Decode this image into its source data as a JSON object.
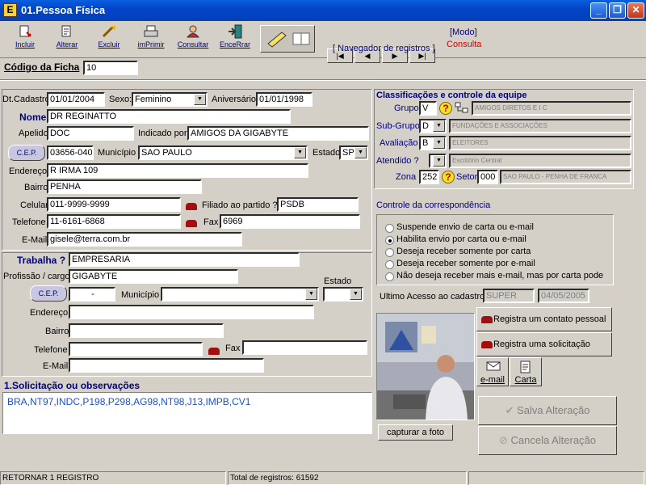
{
  "window": {
    "title": "01.Pessoa Física",
    "app_icon": "E"
  },
  "toolbar": [
    {
      "label": "Incluir",
      "icon": "add-icon"
    },
    {
      "label": "Alterar",
      "icon": "edit-icon"
    },
    {
      "label": "Excluir",
      "icon": "delete-icon"
    },
    {
      "label": "imPrimir",
      "icon": "print-icon"
    },
    {
      "label": "Consultar",
      "icon": "search-icon"
    },
    {
      "label": "EnceRrar",
      "icon": "exit-icon"
    }
  ],
  "navigator": {
    "buttons": [
      "|◀",
      "◀",
      "▶",
      "▶|"
    ],
    "caption": "[ Navegador de registros ]"
  },
  "mode": {
    "label": "[Modo]",
    "value": "Consulta"
  },
  "codigo": {
    "label": "Código da Ficha",
    "value": "10"
  },
  "person": {
    "dt_cadastro_label": "Dt.Cadastro",
    "dt_cadastro": "01/01/2004",
    "sexo_label": "Sexo:",
    "sexo": "Feminino",
    "aniversario_label": "Aniversário",
    "aniversario": "01/01/1998",
    "nome_label": "Nome",
    "nome": "DR REGINATTO",
    "apelido_label": "Apelido",
    "apelido": "DOC",
    "indicado_label": "Indicado por",
    "indicado": "AMIGOS DA GIGABYTE",
    "cep_button": "C.E.P.",
    "cep": "03656-040",
    "municipio_label": "Município",
    "municipio": "SAO PAULO",
    "estado_label": "Estado",
    "estado": "SP",
    "endereco_label": "Endereço",
    "endereco": "R IRMA 109",
    "bairro_label": "Bairro",
    "bairro": "PENHA",
    "celular_label": "Celular",
    "celular": "011-9999-9999",
    "filiado_label": "Filiado ao partido ?",
    "filiado": "PSDB",
    "telefone_label": "Telefone",
    "telefone": "11-6161-6868",
    "fax_label": "Fax",
    "fax": "6969",
    "email_label": "E-Mail",
    "email": "gisele@terra.com.br"
  },
  "work": {
    "trabalha_label": "Trabalha ?",
    "trabalha": "EMPRESARIA",
    "profissao_label": "Profissão / cargo",
    "profissao": "GIGABYTE",
    "estado_label": "Estado",
    "cep_button": "C.E.P.",
    "cep": "-",
    "municipio_label": "Município",
    "endereco_label": "Endereço",
    "bairro_label": "Bairro",
    "telefone_label": "Telefone",
    "fax_label": "Fax",
    "email_label": "E-Mail"
  },
  "obs": {
    "title": "1.Solicitação ou observações",
    "text": "BRA,NT97,INDC,P198,P298,AG98,NT98,J13,IMPB,CV1"
  },
  "classif": {
    "title": "Classificações e controle da equipe",
    "grupo_label": "Grupo",
    "grupo": "V",
    "grupo_desc": "AMIGOS DIRETOS E I C",
    "subgrupo_label": "Sub-Grupo",
    "subgrupo": "D",
    "subgrupo_desc": "FUNDAÇÕES E ASSOCIAÇÕES",
    "avaliacao_label": "Avaliação",
    "avaliacao": "B",
    "avaliacao_desc": "ELEITORES",
    "atendido_label": "Atendido ?",
    "atendido": "1",
    "atendido_desc": "Escritório Central",
    "zona_label": "Zona",
    "zona": "252",
    "setor_label": "Setor",
    "setor": "000",
    "setor_desc": "SAO PAULO - PENHA DE FRANCA"
  },
  "corresp": {
    "title": "Controle da correspondência",
    "options": [
      {
        "label": "Suspende envio de carta ou e-mail",
        "selected": false
      },
      {
        "label": "Habilita envio por carta ou e-mail",
        "selected": true
      },
      {
        "label": "Deseja receber somente por carta",
        "selected": false
      },
      {
        "label": "Deseja receber somente por e-mail",
        "selected": false
      },
      {
        "label": "Não deseja receber mais e-mail, mas por carta pode",
        "selected": false
      }
    ]
  },
  "acesso": {
    "label": "Ultimo Acesso ao cadastro",
    "user": "SUPER",
    "date": "04/05/2005"
  },
  "actions": {
    "contato": "Registra um contato pessoal",
    "solicitacao": "Registra uma solicitação",
    "email": "e-mail",
    "carta": "Carta",
    "salva": "Salva Alteração",
    "cancela": "Cancela Alteração",
    "foto": "capturar a foto"
  },
  "status": {
    "left": "RETORNAR 1 REGISTRO",
    "total": "Total de registros: 61592"
  }
}
